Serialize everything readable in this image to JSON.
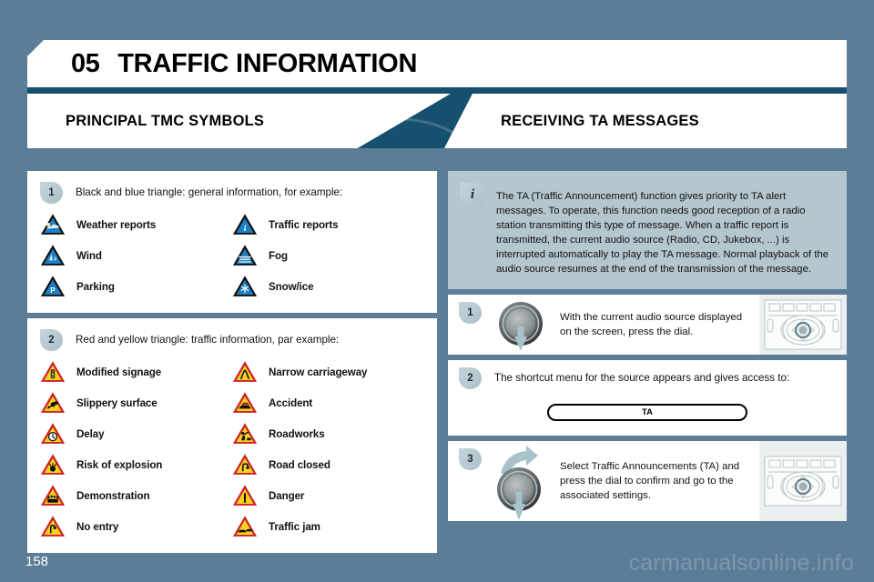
{
  "page": {
    "chapter_number": "05",
    "chapter_title": "TRAFFIC INFORMATION",
    "page_number": "158",
    "watermark": "carmanualsonline.info",
    "accent_dark": "#17506e",
    "background": "#5c7d98",
    "badge_fill": "#b6c8d0",
    "note_fill": "#b4c6ce"
  },
  "left_section": {
    "heading": "PRINCIPAL TMC SYMBOLS",
    "group_blue": {
      "badge": "1",
      "lead": "Black and blue triangle: general information, for example:",
      "symbols": [
        {
          "label": "Weather reports",
          "icon": "blue-triangle-weather-icon"
        },
        {
          "label": "Traffic reports",
          "icon": "blue-triangle-info-icon"
        },
        {
          "label": "Wind",
          "icon": "blue-triangle-wind-icon"
        },
        {
          "label": "Fog",
          "icon": "blue-triangle-fog-icon"
        },
        {
          "label": "Parking",
          "icon": "blue-triangle-parking-icon"
        },
        {
          "label": "Snow/ice",
          "icon": "blue-triangle-snow-icon"
        }
      ]
    },
    "group_red": {
      "badge": "2",
      "lead": "Red and yellow triangle: traffic information, par example:",
      "symbols": [
        {
          "label": "Modified signage",
          "icon": "red-triangle-signage-icon"
        },
        {
          "label": "Narrow carriageway",
          "icon": "red-triangle-narrow-icon"
        },
        {
          "label": "Slippery surface",
          "icon": "red-triangle-slippery-icon"
        },
        {
          "label": "Accident",
          "icon": "red-triangle-accident-icon"
        },
        {
          "label": "Delay",
          "icon": "red-triangle-delay-icon"
        },
        {
          "label": "Roadworks",
          "icon": "red-triangle-roadworks-icon"
        },
        {
          "label": "Risk of explosion",
          "icon": "red-triangle-explosion-icon"
        },
        {
          "label": "Road closed",
          "icon": "red-triangle-closed-icon"
        },
        {
          "label": "Demonstration",
          "icon": "red-triangle-demonstration-icon"
        },
        {
          "label": "Danger",
          "icon": "red-triangle-danger-icon"
        },
        {
          "label": "No entry",
          "icon": "red-triangle-no-entry-icon"
        },
        {
          "label": "Traffic jam",
          "icon": "red-triangle-jam-icon"
        }
      ]
    }
  },
  "right_section": {
    "heading": "RECEIVING TA MESSAGES",
    "note": {
      "badge": "i",
      "text": "The TA (Traffic Announcement) function gives priority to TA alert messages. To operate, this function needs good reception of a radio station transmitting this type of message. When a traffic report is transmitted, the current audio source (Radio, CD, Jukebox, ...) is interrupted automatically to play the TA message. Normal playback of the audio source resumes at the end of the transmission of the message."
    },
    "steps": [
      {
        "badge": "1",
        "text": "With the current audio source displayed on the screen, press the dial.",
        "dial_icon": "dial-press-icon",
        "thumb_icon": "radio-control-panel-icon"
      },
      {
        "badge": "2",
        "text": "The shortcut menu for the source appears and gives access to:",
        "button_label": "TA"
      },
      {
        "badge": "3",
        "text": "Select Traffic Announcements (TA) and press the dial to confirm and go to the associated settings.",
        "dial_icon": "dial-turn-press-icon",
        "thumb_icon": "radio-control-panel-icon"
      }
    ]
  }
}
